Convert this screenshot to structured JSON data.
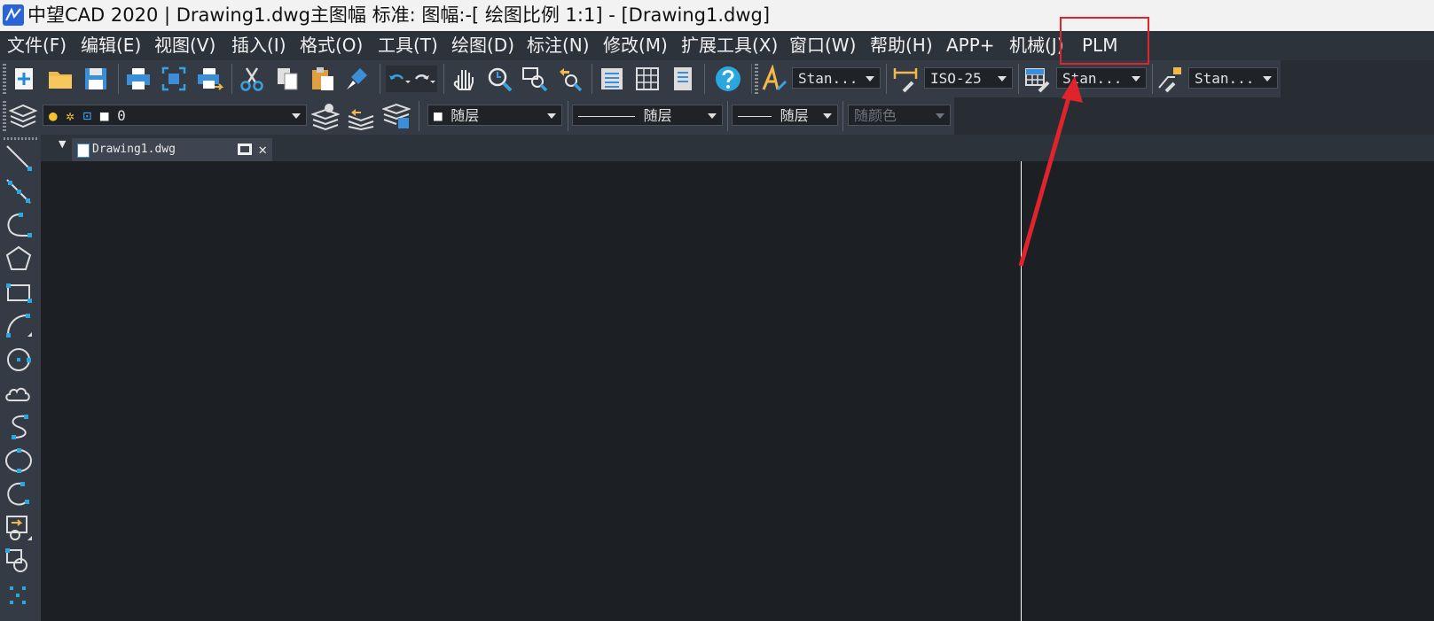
{
  "window": {
    "title": "中望CAD 2020 | Drawing1.dwg主图幅  标准: 图幅:-[ 绘图比例 1:1] - [Drawing1.dwg]"
  },
  "menu": [
    "文件(F)",
    "编辑(E)",
    "视图(V)",
    "插入(I)",
    "格式(O)",
    "工具(T)",
    "绘图(D)",
    "标注(N)",
    "修改(M)",
    "扩展工具(X)",
    "窗口(W)",
    "帮助(H)",
    "APP+",
    "机械(J)",
    "PLM"
  ],
  "toolbar": {
    "text_style": "Stan...",
    "dim_style": "ISO-25",
    "table_style": "Stan...",
    "mleader_style": "Stan..."
  },
  "layers": {
    "current_layer": "0",
    "color": "随层",
    "linetype": "随层",
    "lineweight": "随层",
    "plot_style": "随颜色"
  },
  "tabs": [
    "Drawing1.dwg"
  ],
  "colors": {
    "accent": "#29a8e0",
    "highlight": "#e0242b",
    "canvas": "#1c1f24"
  }
}
